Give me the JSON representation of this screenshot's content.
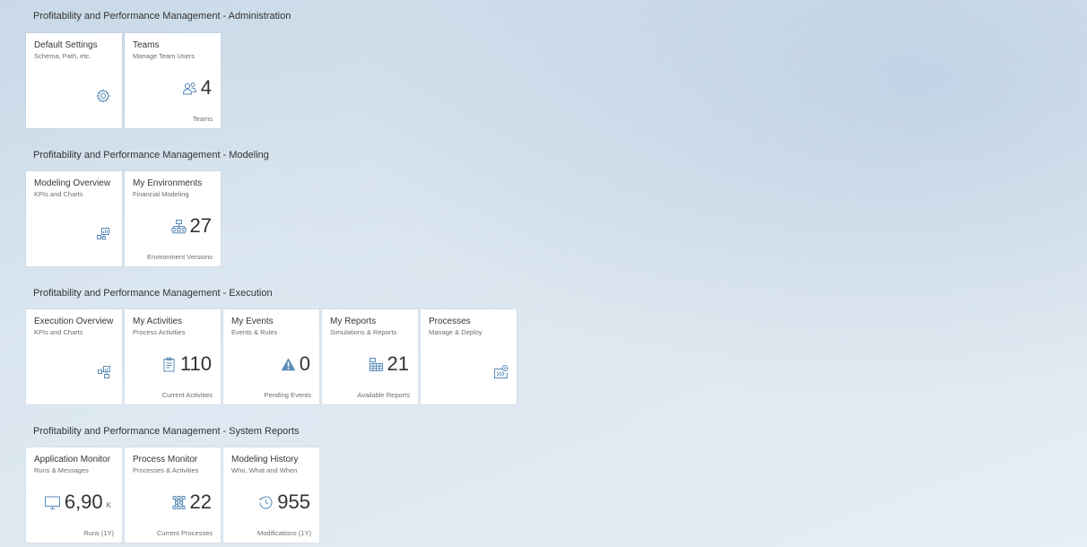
{
  "sections": [
    {
      "title": "Profitability and Performance Management - Administration",
      "tiles": [
        {
          "title": "Default Settings",
          "subtitle": "Schema, Path, etc.",
          "icon": "gear-icon"
        },
        {
          "title": "Teams",
          "subtitle": "Manage Team Users",
          "icon": "group-icon",
          "value": "4",
          "footer": "Teams"
        }
      ]
    },
    {
      "title": "Profitability and Performance Management - Modeling",
      "tiles": [
        {
          "title": "Modeling Overview",
          "subtitle": "KPIs and Charts",
          "icon": "overview-chart-icon"
        },
        {
          "title": "My Environments",
          "subtitle": "Financial Modeling",
          "icon": "hierarchy-icon",
          "value": "27",
          "footer": "Environment Versions"
        }
      ]
    },
    {
      "title": "Profitability and Performance Management - Execution",
      "tiles": [
        {
          "title": "Execution Overview",
          "subtitle": "KPIs and Charts",
          "icon": "execution-overview-icon"
        },
        {
          "title": "My Activities",
          "subtitle": "Process Activities",
          "icon": "clipboard-icon",
          "value": "110",
          "footer": "Current Activities"
        },
        {
          "title": "My Events",
          "subtitle": "Events & Rules",
          "icon": "warning-icon",
          "value": "0",
          "footer": "Pending Events"
        },
        {
          "title": "My Reports",
          "subtitle": "Simulations & Reports",
          "icon": "report-table-icon",
          "value": "21",
          "footer": "Available Reports"
        },
        {
          "title": "Processes",
          "subtitle": "Manage & Deploy",
          "icon": "process-deploy-icon"
        }
      ]
    },
    {
      "title": "Profitability and Performance Management - System Reports",
      "tiles": [
        {
          "title": "Application Monitor",
          "subtitle": "Runs & Messages",
          "icon": "monitor-icon",
          "value": "6,90",
          "unit": "K",
          "footer": "Runs (1Y)"
        },
        {
          "title": "Process Monitor",
          "subtitle": "Processes & Activities",
          "icon": "network-icon",
          "value": "22",
          "footer": "Current Processes"
        },
        {
          "title": "Modeling History",
          "subtitle": "Who, What and When",
          "icon": "history-icon",
          "value": "955",
          "footer": "Modifications (1Y)"
        }
      ]
    }
  ],
  "colors": {
    "accent": "#5b8cb8",
    "tile_background": "#ffffff",
    "text_primary": "#32363a",
    "text_secondary": "#6a6d70"
  }
}
